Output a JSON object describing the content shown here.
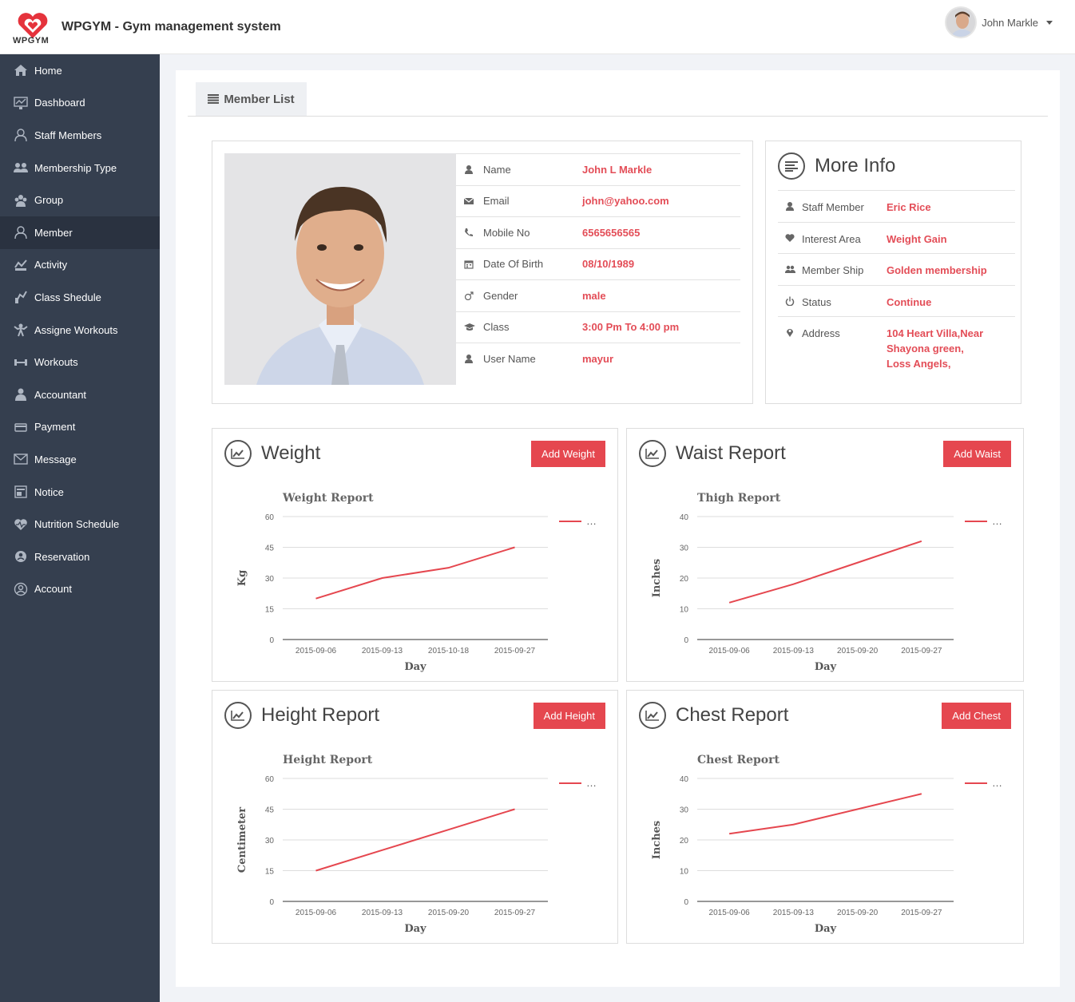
{
  "header": {
    "logo_text": "WPGYM",
    "app_title": "WPGYM - Gym management system",
    "user_name": "John Markle"
  },
  "sidebar": {
    "items": [
      {
        "label": "Home",
        "icon": "home-icon"
      },
      {
        "label": "Dashboard",
        "icon": "dashboard-icon"
      },
      {
        "label": "Staff Members",
        "icon": "staff-icon"
      },
      {
        "label": "Membership Type",
        "icon": "membership-icon"
      },
      {
        "label": "Group",
        "icon": "group-icon"
      },
      {
        "label": "Member",
        "icon": "member-icon"
      },
      {
        "label": "Activity",
        "icon": "activity-icon"
      },
      {
        "label": "Class Shedule",
        "icon": "class-icon"
      },
      {
        "label": "Assigne Workouts",
        "icon": "assign-workout-icon"
      },
      {
        "label": "Workouts",
        "icon": "dumbbell-icon"
      },
      {
        "label": "Accountant",
        "icon": "accountant-icon"
      },
      {
        "label": "Payment",
        "icon": "payment-icon"
      },
      {
        "label": "Message",
        "icon": "message-icon"
      },
      {
        "label": "Notice",
        "icon": "notice-icon"
      },
      {
        "label": "Nutrition Schedule",
        "icon": "nutrition-icon"
      },
      {
        "label": "Reservation",
        "icon": "reservation-icon"
      },
      {
        "label": "Account",
        "icon": "account-icon"
      }
    ],
    "active": "Member"
  },
  "tabs": {
    "member_list": "Member List"
  },
  "profile": {
    "rows": [
      {
        "label": "Name",
        "value": "John L Markle",
        "icon": "user-icon"
      },
      {
        "label": "Email",
        "value": "john@yahoo.com",
        "icon": "envelope-icon"
      },
      {
        "label": "Mobile No",
        "value": "6565656565",
        "icon": "phone-icon"
      },
      {
        "label": "Date Of Birth",
        "value": "08/10/1989",
        "icon": "calendar-icon"
      },
      {
        "label": "Gender",
        "value": "male",
        "icon": "male-icon"
      },
      {
        "label": "Class",
        "value": "3:00 Pm To 4:00 pm",
        "icon": "graduation-cap-icon"
      },
      {
        "label": "User Name",
        "value": "mayur",
        "icon": "user-icon"
      }
    ]
  },
  "more_info": {
    "title": "More Info",
    "rows": [
      {
        "label": "Staff Member",
        "value": "Eric Rice",
        "icon": "user-icon"
      },
      {
        "label": "Interest Area",
        "value": "Weight Gain",
        "icon": "heart-icon"
      },
      {
        "label": "Member Ship",
        "value": "Golden membership",
        "icon": "users-icon"
      },
      {
        "label": "Status",
        "value": "Continue",
        "icon": "power-icon"
      },
      {
        "label": "Address",
        "value": "104 Heart Villa,Near\nShayona green,\nLoss Angels,",
        "icon": "map-marker-icon"
      }
    ]
  },
  "panels": {
    "weight": {
      "title": "Weight",
      "button": "Add Weight"
    },
    "waist": {
      "title": "Waist Report",
      "button": "Add Waist"
    },
    "height": {
      "title": "Height Report",
      "button": "Add Height"
    },
    "chest": {
      "title": "Chest Report",
      "button": "Add Chest"
    }
  },
  "colors": {
    "accent": "#e5474f",
    "sidebar": "#353f4f",
    "value_red": "#e34d57"
  },
  "chart_data": [
    {
      "type": "line",
      "title": "Weight Report",
      "xlabel": "Day",
      "ylabel": "Kg",
      "categories": [
        "2015-09-06",
        "2015-09-13",
        "2015-10-18",
        "2015-09-27"
      ],
      "series": [
        {
          "values": [
            20,
            30,
            35,
            45
          ]
        }
      ],
      "ylim": [
        0,
        60
      ],
      "yticks": [
        0,
        15,
        30,
        45,
        60
      ],
      "legend": "…",
      "legend_position": "top-right",
      "grid": true
    },
    {
      "type": "line",
      "title": "Thigh Report",
      "xlabel": "Day",
      "ylabel": "Inches",
      "categories": [
        "2015-09-06",
        "2015-09-13",
        "2015-09-20",
        "2015-09-27"
      ],
      "series": [
        {
          "values": [
            12,
            18,
            25,
            32
          ]
        }
      ],
      "ylim": [
        0,
        40
      ],
      "yticks": [
        0,
        10,
        20,
        30,
        40
      ],
      "legend": "…",
      "legend_position": "top-right",
      "grid": true
    },
    {
      "type": "line",
      "title": "Height Report",
      "xlabel": "Day",
      "ylabel": "Centimeter",
      "categories": [
        "2015-09-06",
        "2015-09-13",
        "2015-09-20",
        "2015-09-27"
      ],
      "series": [
        {
          "values": [
            15,
            25,
            35,
            45
          ]
        }
      ],
      "ylim": [
        0,
        60
      ],
      "yticks": [
        0,
        15,
        30,
        45,
        60
      ],
      "legend": "…",
      "legend_position": "top-right",
      "grid": true
    },
    {
      "type": "line",
      "title": "Chest Report",
      "xlabel": "Day",
      "ylabel": "Inches",
      "categories": [
        "2015-09-06",
        "2015-09-13",
        "2015-09-20",
        "2015-09-27"
      ],
      "series": [
        {
          "values": [
            22,
            25,
            30,
            35
          ]
        }
      ],
      "ylim": [
        0,
        40
      ],
      "yticks": [
        0,
        10,
        20,
        30,
        40
      ],
      "legend": "…",
      "legend_position": "top-right",
      "grid": true
    }
  ]
}
